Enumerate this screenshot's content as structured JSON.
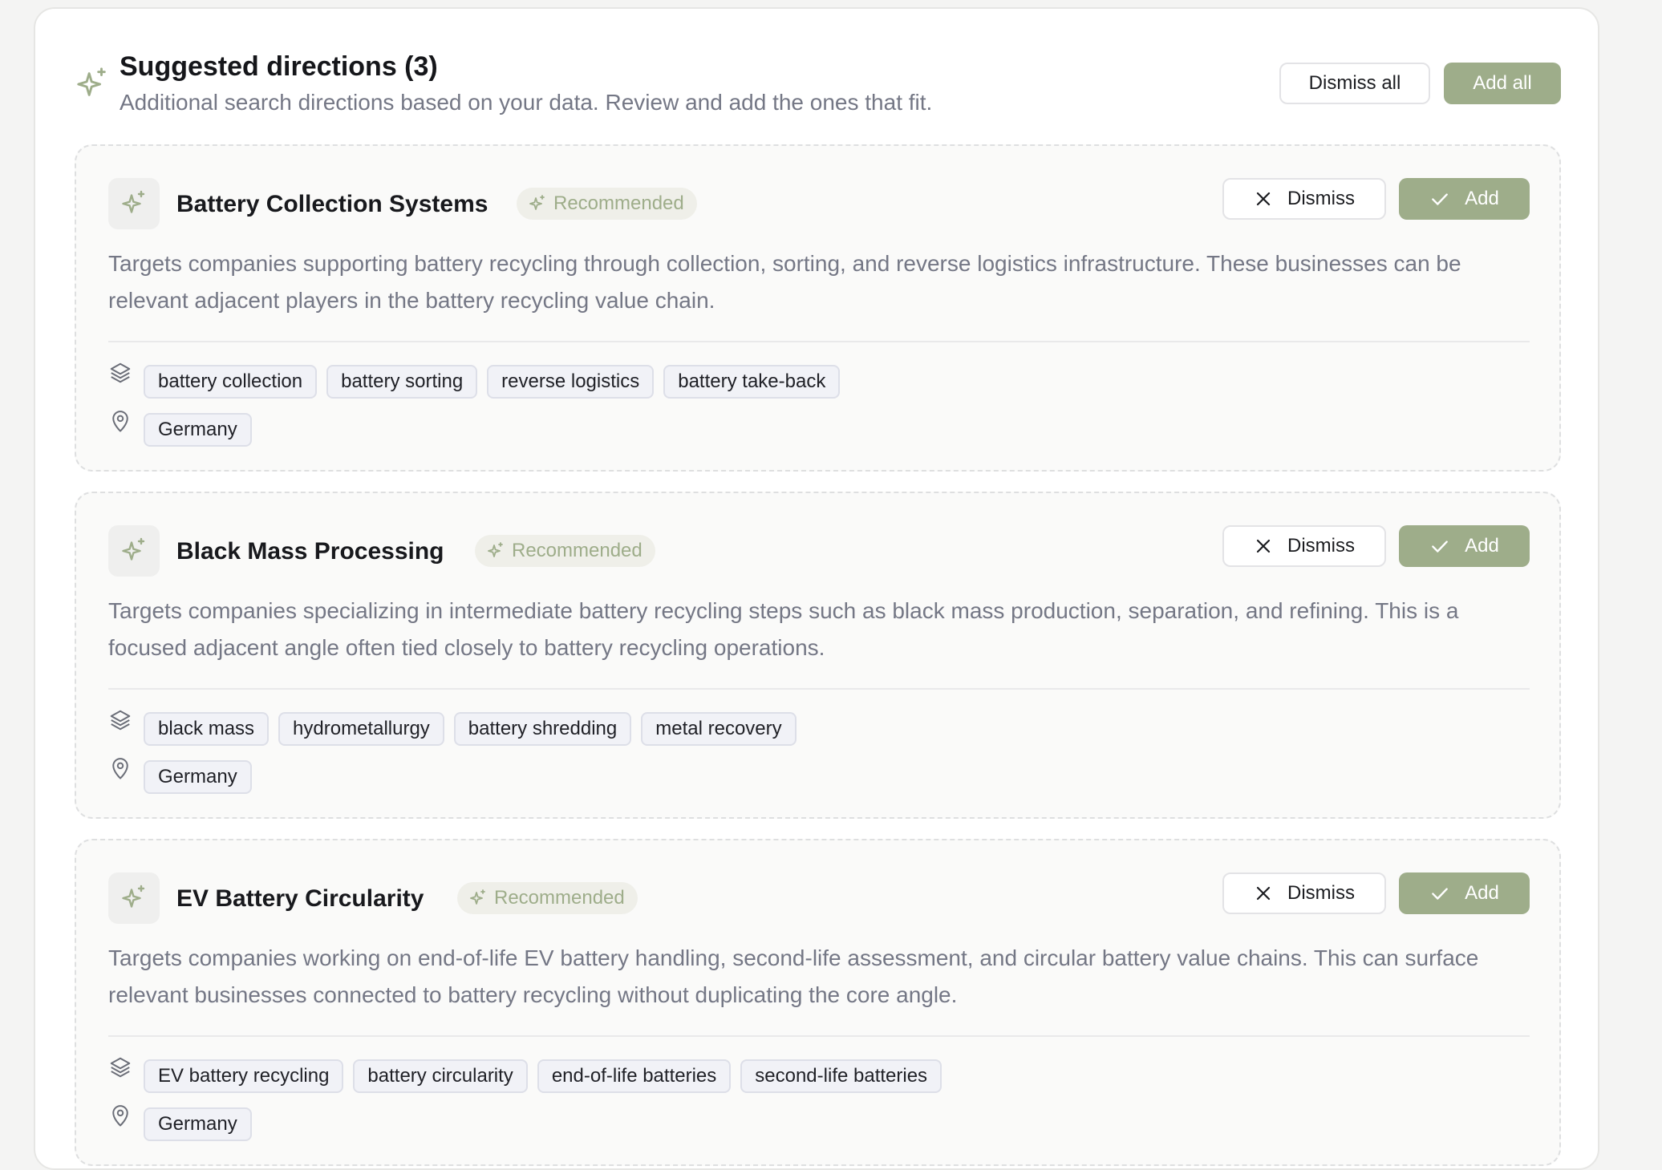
{
  "header": {
    "title": "Suggested directions (3)",
    "subtitle": "Additional search directions based on your data. Review and add the ones that fit.",
    "dismiss_all_label": "Dismiss all",
    "add_all_label": "Add all"
  },
  "colors": {
    "accent": "#9ead8a",
    "muted_text": "#747785",
    "chip_bg": "#f1f2f7"
  },
  "cards": [
    {
      "title": "Battery Collection Systems",
      "badge": "Recommended",
      "dismiss_label": "Dismiss",
      "add_label": "Add",
      "description": "Targets companies supporting battery recycling through collection, sorting, and reverse logistics infrastructure. These businesses can be relevant adjacent players in the battery recycling value chain.",
      "keywords": [
        "battery collection",
        "battery sorting",
        "reverse logistics",
        "battery take-back"
      ],
      "locations": [
        "Germany"
      ],
      "icons": {
        "card": "sparkles-icon",
        "keywords": "layers-icon",
        "location": "map-pin-icon"
      }
    },
    {
      "title": "Black Mass Processing",
      "badge": "Recommended",
      "dismiss_label": "Dismiss",
      "add_label": "Add",
      "description": "Targets companies specializing in intermediate battery recycling steps such as black mass production, separation, and refining. This is a focused adjacent angle often tied closely to battery recycling operations.",
      "keywords": [
        "black mass",
        "hydrometallurgy",
        "battery shredding",
        "metal recovery"
      ],
      "locations": [
        "Germany"
      ],
      "icons": {
        "card": "sparkles-icon",
        "keywords": "layers-icon",
        "location": "map-pin-icon"
      }
    },
    {
      "title": "EV Battery Circularity",
      "badge": "Recommended",
      "dismiss_label": "Dismiss",
      "add_label": "Add",
      "description": "Targets companies working on end-of-life EV battery handling, second-life assessment, and circular battery value chains. This can surface relevant businesses connected to battery recycling without duplicating the core angle.",
      "keywords": [
        "EV battery recycling",
        "battery circularity",
        "end-of-life batteries",
        "second-life batteries"
      ],
      "locations": [
        "Germany"
      ],
      "icons": {
        "card": "sparkles-icon",
        "keywords": "layers-icon",
        "location": "map-pin-icon"
      }
    }
  ]
}
